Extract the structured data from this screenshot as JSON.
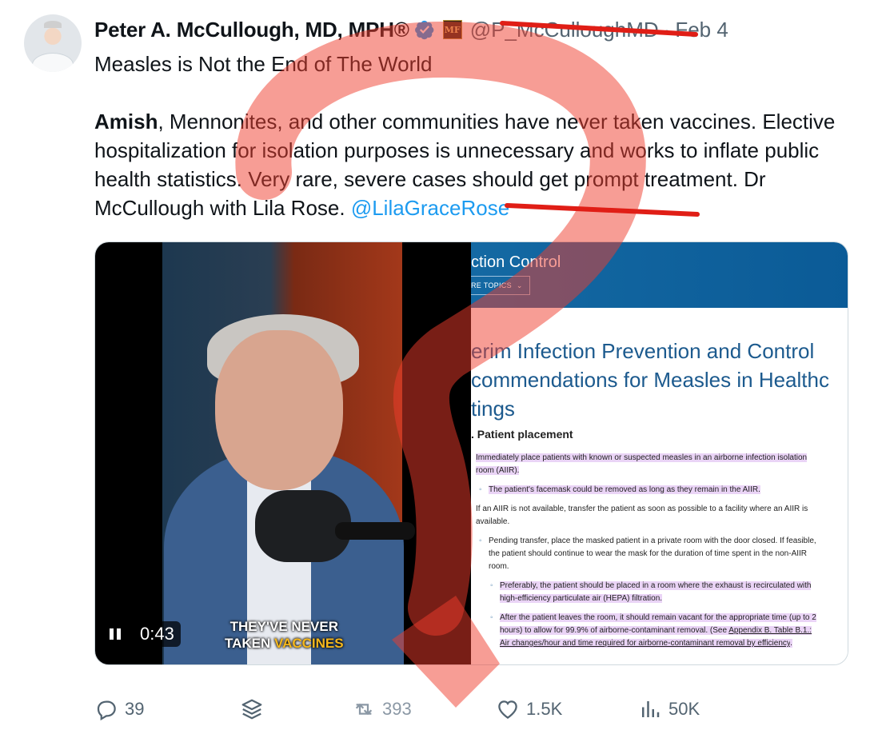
{
  "tweet": {
    "author_name": "Peter A. McCullough, MD, MPH®",
    "handle": "@P_McCulloughMD",
    "separator": "·",
    "date": "Feb 4",
    "text_line1": "Measles is Not the End of The World",
    "text_p2_bold": "Amish",
    "text_p2_rest": ", Mennonites, and other communities have never taken vaccines. Elective hospitalization for isolation purposes is unnecessary and works to inflate public health statistics. Very rare, severe cases should get prompt treatment.  Dr McCullough with Lila Rose. ",
    "mention": "@LilaGraceRose"
  },
  "org_badge": "MF",
  "video": {
    "time": "0:43",
    "caption_line1": "THEY'VE NEVER",
    "caption_line2_a": "TAKEN ",
    "caption_line2_b": "VACCINES"
  },
  "document": {
    "nav_title": "ction Control",
    "topics_label": "RE TOPICS",
    "heading_line1": "erim Infection Prevention and Control",
    "heading_line2": "commendations for Measles in Healthc",
    "heading_line3": "tings",
    "subheading": ". Patient placement",
    "items": [
      "Immediately place patients with known or suspected measles in an airborne infection isolation room (AIIR).",
      "The patient's facemask could be removed as long as they remain in the AIIR.",
      "If an AIIR is not available, transfer the patient as soon as possible to a facility where an AIIR is available.",
      "Pending transfer, place the masked patient in a private room with the door closed. If feasible, the patient should continue to wear the mask for the duration of time spent in the non-AIIR room.",
      "Preferably, the patient should be placed in a room where the exhaust is recirculated with high-efficiency particulate air (HEPA) filtration.",
      "After the patient leaves the room, it should remain vacant for the appropriate time (up to 2 hours) to allow for 99.9% of airborne-contaminant removal. (See ",
      "Appendix B. Table B.1.: Air changes/hour and time required for airborne-contaminant removal by efficiency",
      "."
    ]
  },
  "actions": {
    "replies": "39",
    "retweets": "393",
    "likes": "1.5K",
    "views": "50K"
  },
  "colors": {
    "accent": "#1d9bf0",
    "annotation": "#ef3b2c",
    "muted": "#536471"
  }
}
